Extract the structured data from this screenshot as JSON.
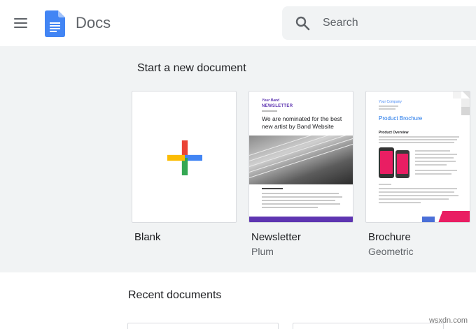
{
  "header": {
    "app_title": "Docs",
    "search_placeholder": "Search"
  },
  "templates": {
    "section_title": "Start a new document",
    "items": [
      {
        "title": "Blank",
        "subtitle": ""
      },
      {
        "title": "Newsletter",
        "subtitle": "Plum"
      },
      {
        "title": "Brochure",
        "subtitle": "Geometric"
      }
    ],
    "newsletter_preview": {
      "brand": "Your Band",
      "name": "NEWSLETTER",
      "headline": "We are nominated for the best new artist by Band Website"
    },
    "brochure_preview": {
      "company": "Your Company",
      "title": "Product Brochure",
      "overview": "Product Overview"
    }
  },
  "recent": {
    "section_title": "Recent documents"
  },
  "watermark": "wsxdn.com",
  "colors": {
    "accent_blue": "#4285f4",
    "plum": "#5e35b1",
    "pink": "#e91e63",
    "gallery_bg": "#f1f3f4"
  }
}
